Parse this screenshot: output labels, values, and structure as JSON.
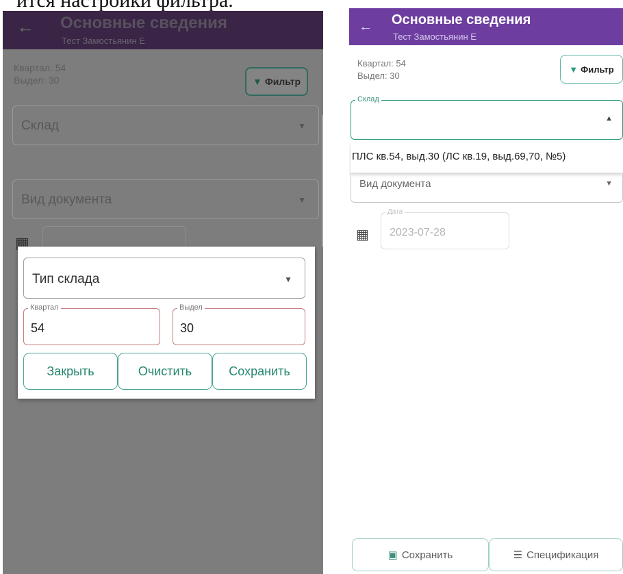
{
  "caption": "ится настройки фильтра.",
  "left_screen": {
    "appbar": {
      "back_icon": "arrow-left-icon",
      "title": "Основные сведения",
      "subtitle": "Тест Замостьянин Е"
    },
    "info": {
      "quarter": "Квартал: 54",
      "section": "Выдел: 30"
    },
    "filter_button": "Фильтр",
    "warehouse_field": "Склад",
    "doc_type_field": "Вид документа",
    "modal": {
      "warehouse_type": "Тип склада",
      "quarter_label": "Квартал",
      "quarter_value": "54",
      "section_label": "Выдел",
      "section_value": "30",
      "close": "Закрыть",
      "clear": "Очистить",
      "save": "Сохранить"
    }
  },
  "right_screen": {
    "appbar": {
      "back_icon": "arrow-left-icon",
      "title": "Основные сведения",
      "subtitle": "Тест Замостьянин Е"
    },
    "info": {
      "quarter": "Квартал: 54",
      "section": "Выдел: 30"
    },
    "filter_button": "Фильтр",
    "warehouse_label": "Склад",
    "dropdown_option": "ПЛС кв.54, выд.30 (ЛС кв.19, выд.69,70, №5)",
    "doc_type_field": "Вид документа",
    "date_label": "Дата",
    "date_value": "2023-07-28",
    "save_button": "Сохранить",
    "spec_button": "Спецификация"
  },
  "colors": {
    "appbar_right": "#6d3ea0",
    "accent": "#2a9a7c",
    "appbar_left_dim": "#3a2546"
  }
}
